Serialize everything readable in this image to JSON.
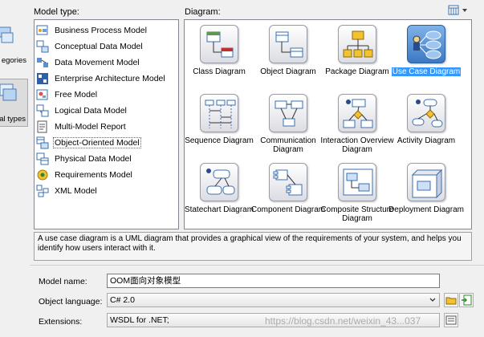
{
  "left_panel": {
    "categories": [
      {
        "label": "egories",
        "icon": "category-icon"
      },
      {
        "label": "al types",
        "icon": "model-types-icon",
        "selected": true
      }
    ]
  },
  "model_type_label": "Model type:",
  "diagram_label": "Diagram:",
  "view_toggle_icon": "list-view-icon",
  "models": [
    {
      "label": "Business Process Model",
      "icon": "business-process-icon"
    },
    {
      "label": "Conceptual Data Model",
      "icon": "conceptual-data-icon"
    },
    {
      "label": "Data Movement Model",
      "icon": "data-movement-icon"
    },
    {
      "label": "Enterprise Architecture Model",
      "icon": "enterprise-architecture-icon"
    },
    {
      "label": "Free Model",
      "icon": "free-model-icon"
    },
    {
      "label": "Logical Data Model",
      "icon": "logical-data-icon"
    },
    {
      "label": "Multi-Model Report",
      "icon": "multi-model-report-icon"
    },
    {
      "label": "Object-Oriented Model",
      "icon": "object-oriented-icon",
      "selected": true
    },
    {
      "label": "Physical Data Model",
      "icon": "physical-data-icon"
    },
    {
      "label": "Requirements Model",
      "icon": "requirements-icon"
    },
    {
      "label": "XML Model",
      "icon": "xml-model-icon"
    }
  ],
  "diagrams": [
    {
      "label": "Class Diagram",
      "icon": "class-diagram-icon"
    },
    {
      "label": "Object Diagram",
      "icon": "object-diagram-icon"
    },
    {
      "label": "Package Diagram",
      "icon": "package-diagram-icon"
    },
    {
      "label": "Use Case Diagram",
      "icon": "use-case-diagram-icon",
      "selected": true
    },
    {
      "label": "Sequence Diagram",
      "icon": "sequence-diagram-icon"
    },
    {
      "label": "Communication Diagram",
      "icon": "communication-diagram-icon"
    },
    {
      "label": "Interaction Overview Diagram",
      "icon": "interaction-overview-icon"
    },
    {
      "label": "Activity Diagram",
      "icon": "activity-diagram-icon"
    },
    {
      "label": "Statechart Diagram",
      "icon": "statechart-diagram-icon"
    },
    {
      "label": "Component Diagram",
      "icon": "component-diagram-icon"
    },
    {
      "label": "Composite Structure Diagram",
      "icon": "composite-structure-icon"
    },
    {
      "label": "Deployment Diagram",
      "icon": "deployment-diagram-icon"
    }
  ],
  "description": "A use case diagram is a UML diagram that provides a graphical view of the requirements of your system, and helps you identify how users interact with it.",
  "form": {
    "model_name_label": "Model name:",
    "model_name_value": "OOM面向对象模型",
    "object_language_label": "Object language:",
    "object_language_value": "C# 2.0",
    "extensions_label": "Extensions:",
    "extensions_value": "WSDL for .NET;"
  },
  "watermark": "https://blog.csdn.net/weixin_43...037",
  "colors": {
    "selection": "#3399ff",
    "selected_icon": "#3c79c4",
    "background": "#f0f0f0"
  }
}
